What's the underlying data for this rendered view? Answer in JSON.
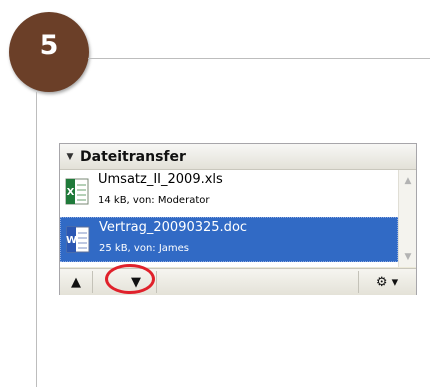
{
  "step": {
    "number": "5",
    "color": "#6b3f28"
  },
  "panel": {
    "title": "Dateitransfer",
    "collapse_icon": "triangle-down-icon"
  },
  "files": [
    {
      "name": "Umsatz_II_2009.xls",
      "meta": "14 kB, von: Moderator",
      "icon": "excel-file-icon",
      "selected": false
    },
    {
      "name": "Vertrag_20090325.doc",
      "meta": "25 kB, von: James",
      "icon": "word-file-icon",
      "selected": true
    }
  ],
  "toolbar": {
    "buttons": [
      {
        "icon": "arrow-up-icon",
        "glyph": "▲"
      },
      {
        "icon": "arrow-down-icon",
        "glyph": "▼"
      },
      {
        "icon": "gear-menu-icon",
        "glyph": "⚙ ▾"
      }
    ]
  },
  "colors": {
    "selection": "#316ac5",
    "highlight_ring": "#e0212b"
  }
}
